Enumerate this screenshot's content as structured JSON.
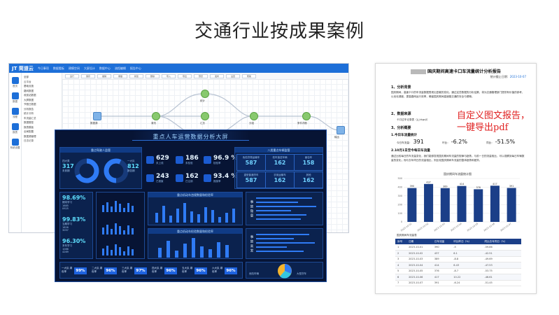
{
  "slide": {
    "title": "交通行业按成果案例"
  },
  "app": {
    "logo": "JT 简道云",
    "top_tabs": [
      "今日事项",
      "数据看板",
      "建模空间",
      "大屏设计",
      "数据中心",
      "流程编辑",
      "报告中心"
    ],
    "side_items": [
      "首页",
      "数据",
      "流程",
      "报表",
      "系统设置"
    ],
    "tree": [
      "全部",
      "云平台",
      "基础设施",
      "路网数据",
      "收费站数据",
      "大屏数据",
      "节假日数据",
      "分析报告",
      "统计分析",
      "车流量汇总",
      "数据模型",
      "报表模板",
      "全局配置",
      "数据源管理",
      "日志记录"
    ],
    "toolbar": [
      "运行",
      "保存",
      "撤销",
      "重做",
      "新建",
      "删除",
      "导入",
      "导出",
      "预览",
      "发布",
      "设置",
      "帮助"
    ],
    "nodes": [
      "数据源",
      "清洗",
      "统计",
      "汇总",
      "合并",
      "分组",
      "条件判断",
      "输出"
    ]
  },
  "dashboard": {
    "title": "重点人车运营数据分析大屏",
    "left_top_title": "重点驾驶人监管",
    "donut_left": {
      "label": "四大类",
      "value": "317",
      "sub": "未到期"
    },
    "donut_right": {
      "label": "一大队",
      "value": "812",
      "sub": "报告期"
    },
    "kpis": [
      {
        "value": "629",
        "label": "未上线"
      },
      {
        "value": "186",
        "label": "未检验"
      },
      {
        "value": "96.9 %",
        "label": "检验率"
      },
      {
        "value": "243",
        "label": "已报废"
      },
      {
        "value": "162",
        "label": "已注销"
      },
      {
        "value": "93.4 %",
        "label": "报废率"
      }
    ],
    "right_top_title": "八类重点车辆监管",
    "tiles": [
      {
        "label": "危险货物运输车",
        "value": "587"
      },
      {
        "label": "校车接送车辆",
        "value": "162"
      },
      {
        "label": "面包车",
        "value": "158"
      },
      {
        "label": "重型普通货车",
        "value": "587"
      },
      {
        "label": "农用运输车",
        "value": "162"
      },
      {
        "label": "其他",
        "value": "162"
      }
    ],
    "left_stats": [
      {
        "pct": "98.69%",
        "lab1": "期末学习",
        "v1": "1685",
        "v2": "0925"
      },
      {
        "pct": "99.83%",
        "lab1": "当期学习",
        "v1": "1826",
        "v2": "3097"
      },
      {
        "pct": "96.30%",
        "lab1": "本年学习",
        "v1": "1086",
        "v2": "4269"
      }
    ],
    "chart1_title": "重点机动车违规数量和检验率",
    "chart2_title": "重点机动车检验数量和检验率",
    "side_label_1": "事故隐患",
    "side_label_2": "事故高发",
    "pie": {
      "label": "危险车辆",
      "value": "117",
      "unit": "辆"
    },
    "donut_pct": {
      "label": "大型货车",
      "value": "420",
      "unit": "辆"
    },
    "bottom": [
      {
        "name": "一大队 绿色率",
        "pct": "99%"
      },
      {
        "name": "二大队 绿色率",
        "pct": "96%"
      },
      {
        "name": "三大队 绿色率",
        "pct": "97%"
      },
      {
        "name": "四大队 绿色率",
        "pct": "96%"
      },
      {
        "name": "五大队 绿色率",
        "pct": "96%"
      },
      {
        "name": "六大队 绿色率",
        "pct": "96%"
      }
    ]
  },
  "doc": {
    "title": "国庆期间高速卡口车流量统计分析报告",
    "meta_label": "统计截止日期：",
    "meta_date": "2023-10-07",
    "h1": "1、分析背景",
    "p1": "国庆期间，高速卡口的车流量数据受现出显著的变化。通过这些数据的分析结果，将为交通管理部门提供有价值的参考，以优化调度、提高路网运行效率，确保国庆期间高速路交通的安全与顺畅。",
    "h2": "2、数据来源",
    "p2": "卡口过车记录表（jj_kkgcjl）",
    "h3": "3、分析概要",
    "h31": "1.今日车流量统计",
    "stat_today_label": "今日车流量：",
    "stat_today": "391",
    "stat_yoy_label": "环比：",
    "stat_yoy": "-6.2%",
    "stat_mom_label": "同比：",
    "stat_mom": "-51.5%",
    "h32": "2.10月1日至今每日车流量",
    "p3": "通过比较每日的车流量变化，我们能够发现国庆期间车流量的规律与趋势。与前一日的流量相比，可以观察到每日车辆数量的变化；而与去年同日的流量相比，则比较国庆期间车流量的整体趋势和差异。",
    "red_note": "自定义图文报告，一键导出pdf",
    "table_title": "国庆期间车流量表",
    "table_head": [
      "序号",
      "日期",
      "日车流量",
      "环比昨日（%）",
      "同比去年同日（%）"
    ],
    "table_rows": [
      [
        "1",
        "2023-10-01",
        "390",
        "-5",
        "-59.86"
      ],
      [
        "2",
        "2023-10-02",
        "437",
        "6.1",
        "-42.51"
      ],
      [
        "3",
        "2023-10-03",
        "389",
        "-8.8",
        "-49.69"
      ],
      [
        "4",
        "2023-10-04",
        "414",
        "6.43",
        "-47.53"
      ],
      [
        "5",
        "2023-10-05",
        "376",
        "-8.7",
        "-53.75"
      ],
      [
        "6",
        "2023-10-06",
        "417",
        "10.22",
        "-46.61"
      ],
      [
        "7",
        "2023-10-07",
        "391",
        "-6.24",
        "-51.45"
      ]
    ]
  },
  "chart_data": {
    "type": "bar",
    "title": "国庆期间车流量统计图",
    "categories": [
      "2023-10-01",
      "2023-10-02",
      "2023-10-03",
      "2023-10-04",
      "2023-10-05",
      "2023-10-06",
      "2023-10-07"
    ],
    "values": [
      390,
      437,
      389,
      414,
      376,
      417,
      391
    ],
    "ylim": [
      0,
      500
    ],
    "yticks": [
      0,
      100,
      200,
      300,
      400,
      500
    ],
    "color": "#1b3f88"
  }
}
